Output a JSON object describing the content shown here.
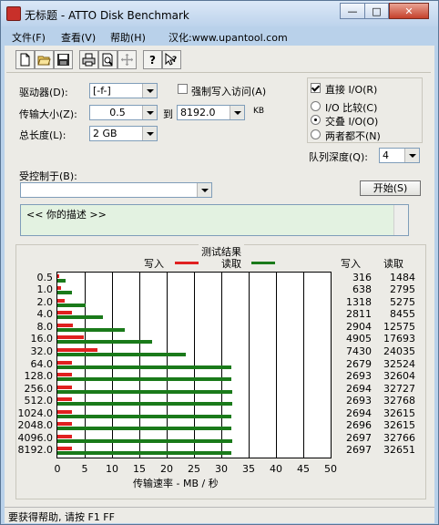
{
  "window": {
    "title": "无标题 - ATTO Disk Benchmark",
    "min": "—",
    "max": "□",
    "close": "✕"
  },
  "menu": [
    "文件(F)",
    "查看(V)",
    "帮助(H)",
    "汉化:www.upantool.com"
  ],
  "toolbar": [
    "new-file-icon",
    "open-folder-icon",
    "save-icon",
    "print-icon",
    "print-preview-icon",
    "move-icon",
    "help-icon",
    "context-help-icon"
  ],
  "form": {
    "drive_label": "驱动器(D):",
    "drive_value": "[-f-]",
    "force_write_label": "强制写入访问(A)",
    "transfer_label": "传输大小(Z):",
    "transfer_from": "0.5",
    "transfer_to_label": "到",
    "transfer_to": "8192.0",
    "transfer_unit": "KB",
    "total_label": "总长度(L):",
    "total_value": "2 GB",
    "controlled_label": "受控制于(B):",
    "controlled_value": "",
    "direct_io_label": "直接 I/O(R)",
    "io_compare_label": "I/O 比较(C)",
    "overlapped_io_label": "交叠 I/O(O)",
    "neither_label": "两者都不(N)",
    "queue_label": "队列深度(Q):",
    "queue_value": "4",
    "start_button": "开始(S)",
    "description": "<<   你的描述    >>"
  },
  "results": {
    "title": "测试结果",
    "legend_write": "写入",
    "legend_read": "读取",
    "col_write": "写入",
    "col_read": "读取",
    "xlabel": "传输速率 - MB / 秒",
    "colors": {
      "write": "#e02020",
      "read": "#1a7a1a"
    }
  },
  "chart_data": {
    "type": "bar",
    "orientation": "horizontal",
    "categories": [
      "0.5",
      "1.0",
      "2.0",
      "4.0",
      "8.0",
      "16.0",
      "32.0",
      "64.0",
      "128.0",
      "256.0",
      "512.0",
      "1024.0",
      "2048.0",
      "4096.0",
      "8192.0"
    ],
    "series": [
      {
        "name": "写入",
        "values": [
          316,
          638,
          1318,
          2811,
          2904,
          4905,
          7430,
          2679,
          2693,
          2694,
          2693,
          2694,
          2696,
          2697,
          2697
        ]
      },
      {
        "name": "读取",
        "values": [
          1484,
          2795,
          5275,
          8455,
          12575,
          17693,
          24035,
          32524,
          32604,
          32727,
          32768,
          32615,
          32615,
          32766,
          32651
        ]
      }
    ],
    "xticks": [
      "0",
      "5",
      "10",
      "15",
      "20",
      "25",
      "30",
      "35",
      "40",
      "45",
      "50"
    ],
    "xlim": [
      0,
      50
    ],
    "grid": true,
    "legend": "top"
  },
  "status": {
    "text": "要获得帮助, 请按 F1 FF"
  }
}
